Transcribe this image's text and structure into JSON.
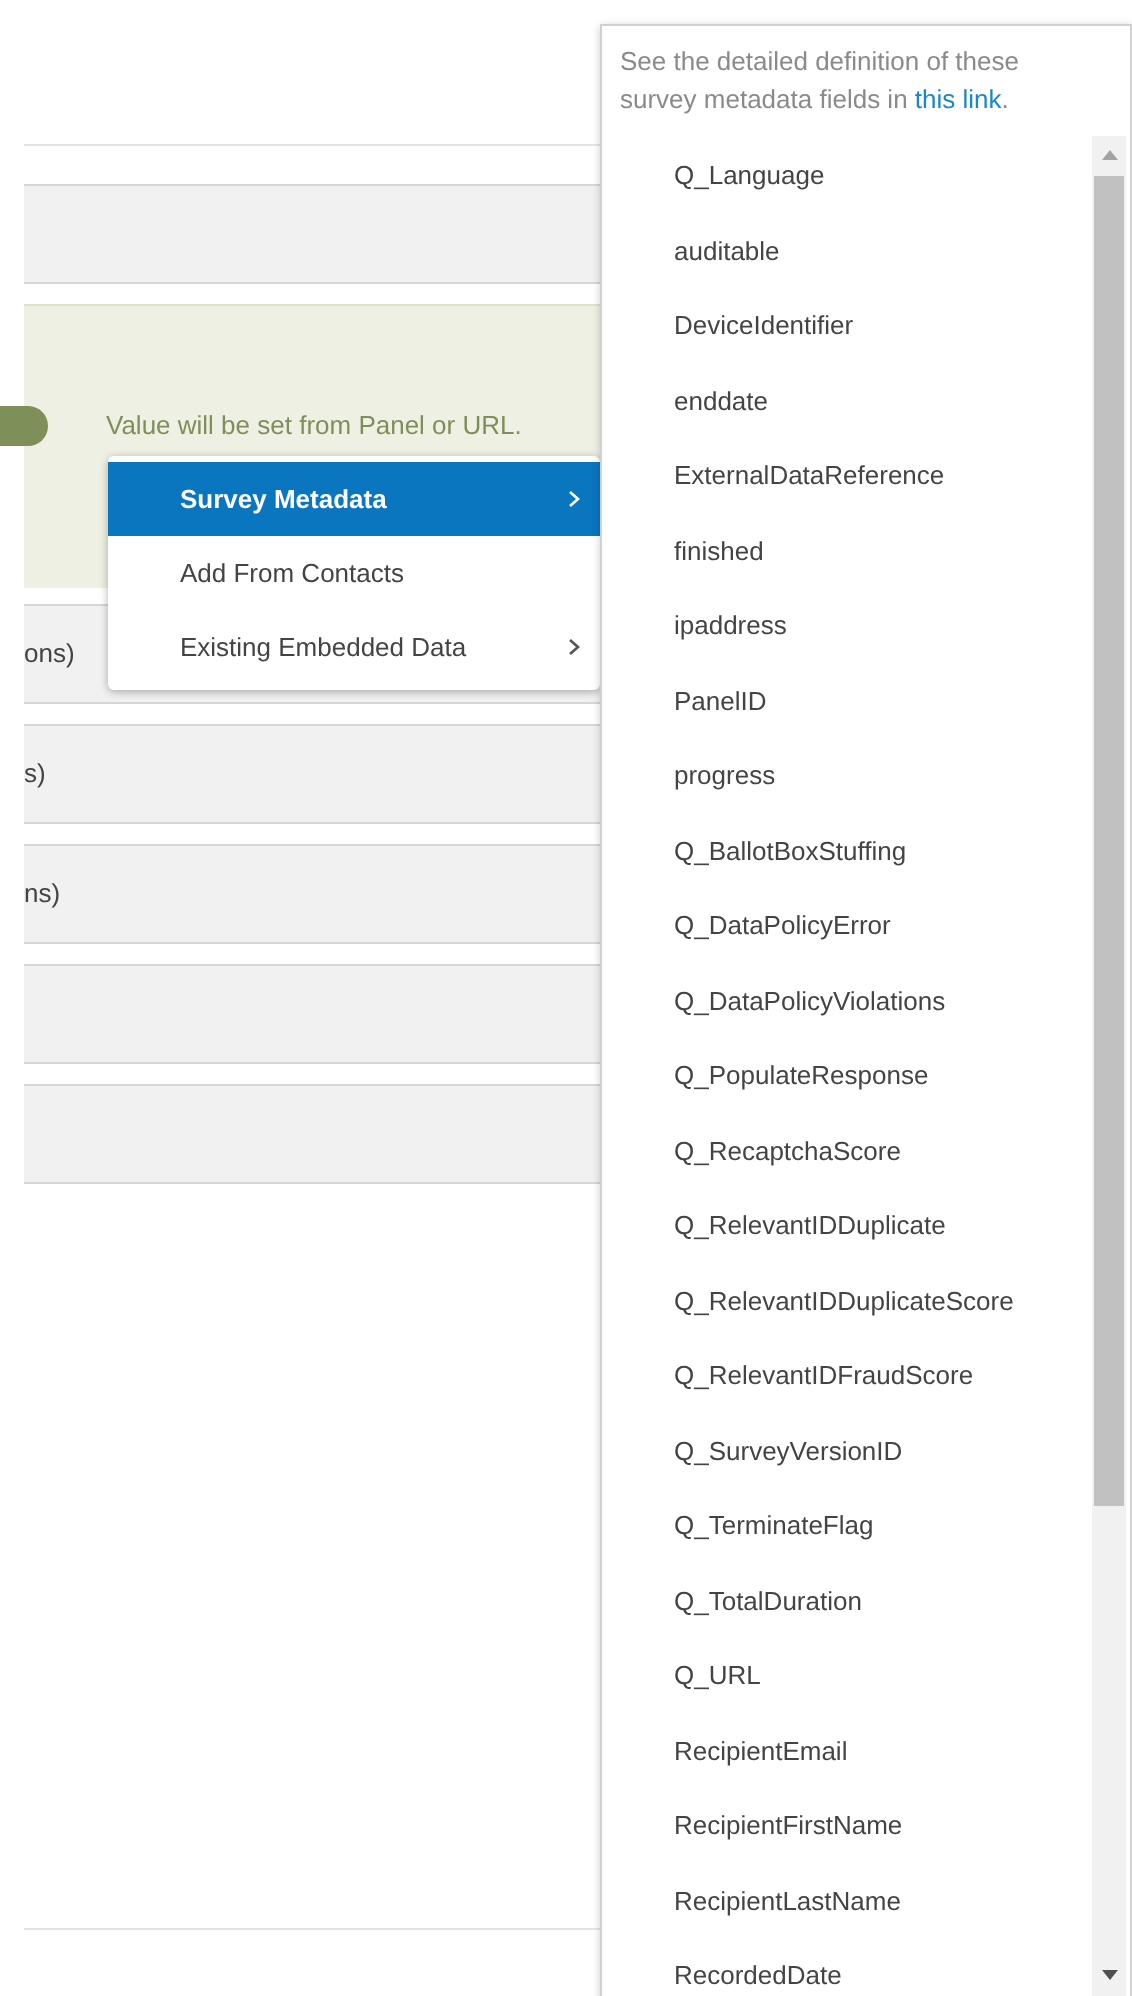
{
  "background": {
    "notice": "Value will be set from Panel or URL.",
    "rows": [
      {
        "text": "ons)"
      },
      {
        "text": "s)"
      },
      {
        "text": "ns)"
      },
      {
        "text": ""
      },
      {
        "text": ""
      }
    ]
  },
  "menu": {
    "items": [
      {
        "label": "Survey Metadata",
        "selected": true,
        "submenu": true
      },
      {
        "label": "Add From Contacts",
        "selected": false,
        "submenu": false
      },
      {
        "label": "Existing Embedded Data",
        "selected": false,
        "submenu": true
      }
    ]
  },
  "submenu": {
    "note": "See the detailed definition of these survey metadata fields in",
    "link": "this link",
    "note_end": ".",
    "items": [
      "Q_Language",
      "auditable",
      "DeviceIdentifier",
      "enddate",
      "ExternalDataReference",
      "finished",
      "ipaddress",
      "PanelID",
      "progress",
      "Q_BallotBoxStuffing",
      "Q_DataPolicyError",
      "Q_DataPolicyViolations",
      "Q_PopulateResponse",
      "Q_RecaptchaScore",
      "Q_RelevantIDDuplicate",
      "Q_RelevantIDDuplicateScore",
      "Q_RelevantIDFraudScore",
      "Q_SurveyVersionID",
      "Q_TerminateFlag",
      "Q_TotalDuration",
      "Q_URL",
      "RecipientEmail",
      "RecipientFirstName",
      "RecipientLastName",
      "RecordedDate"
    ]
  }
}
